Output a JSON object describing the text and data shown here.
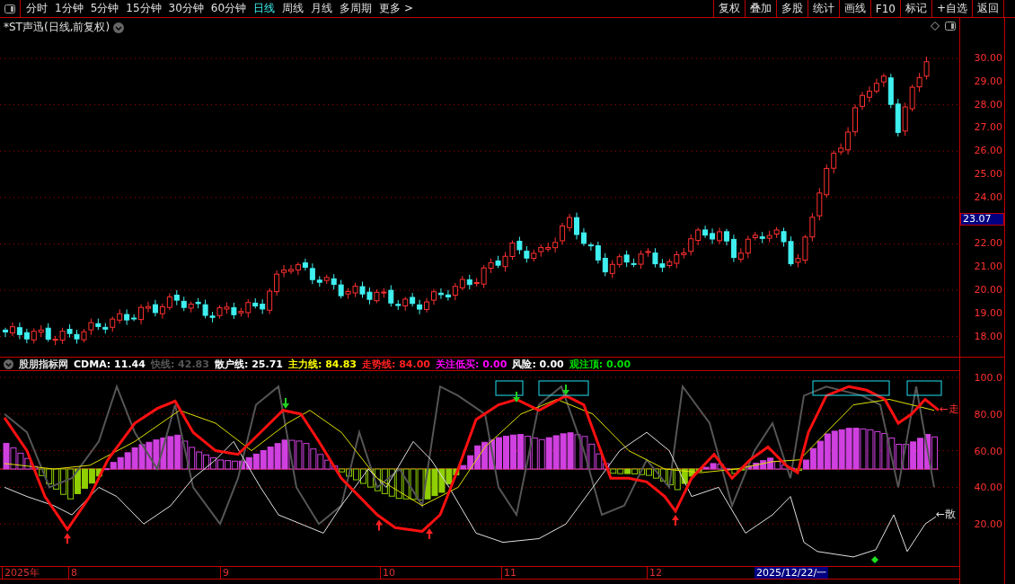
{
  "toolbar": {
    "periods": [
      {
        "label": "分时",
        "selected": false
      },
      {
        "label": "1分钟",
        "selected": false
      },
      {
        "label": "5分钟",
        "selected": false
      },
      {
        "label": "15分钟",
        "selected": false
      },
      {
        "label": "30分钟",
        "selected": false
      },
      {
        "label": "60分钟",
        "selected": false
      },
      {
        "label": "日线",
        "selected": true
      },
      {
        "label": "周线",
        "selected": false
      },
      {
        "label": "月线",
        "selected": false
      },
      {
        "label": "多周期",
        "selected": false
      },
      {
        "label": "更多 >",
        "selected": false
      }
    ],
    "actions": [
      "复权",
      "叠加",
      "多股",
      "统计",
      "画线",
      "F10",
      "标记",
      "+自选",
      "返回"
    ]
  },
  "price_panel": {
    "title": "*ST声迅(日线,前复权)",
    "axis_labels": [
      "30.00",
      "29.00",
      "28.00",
      "27.00",
      "26.00",
      "25.00",
      "24.00",
      "22.00",
      "21.00",
      "20.00",
      "19.00",
      "18.00"
    ],
    "current_price": "23.07"
  },
  "indicator": {
    "name": "股朋指标网",
    "readouts": [
      {
        "text": "CDMA: 11.44",
        "color": "#ffffff"
      },
      {
        "text": "快线: 42.83",
        "color": "#555555"
      },
      {
        "text": "散户线: 25.71",
        "color": "#ffffff"
      },
      {
        "text": "主力线: 84.83",
        "color": "#ffff00"
      },
      {
        "text": "走势线: 84.00",
        "color": "#ff2020"
      },
      {
        "text": "关注低买: 0.00",
        "color": "#ff00ff"
      },
      {
        "text": "风险: 0.00",
        "color": "#ffffff"
      },
      {
        "text": "观注顶: 0.00",
        "color": "#00dd00"
      }
    ],
    "axis_labels": [
      "100.0",
      "80.00",
      "60.00",
      "40.00",
      "20.00"
    ],
    "trend_tag": "←走",
    "retail_tag": "←散"
  },
  "date_axis": {
    "labels": [
      "2025年",
      "8",
      "9",
      "10",
      "11",
      "12"
    ],
    "cursor_date": "2025/12/22/一"
  }
}
